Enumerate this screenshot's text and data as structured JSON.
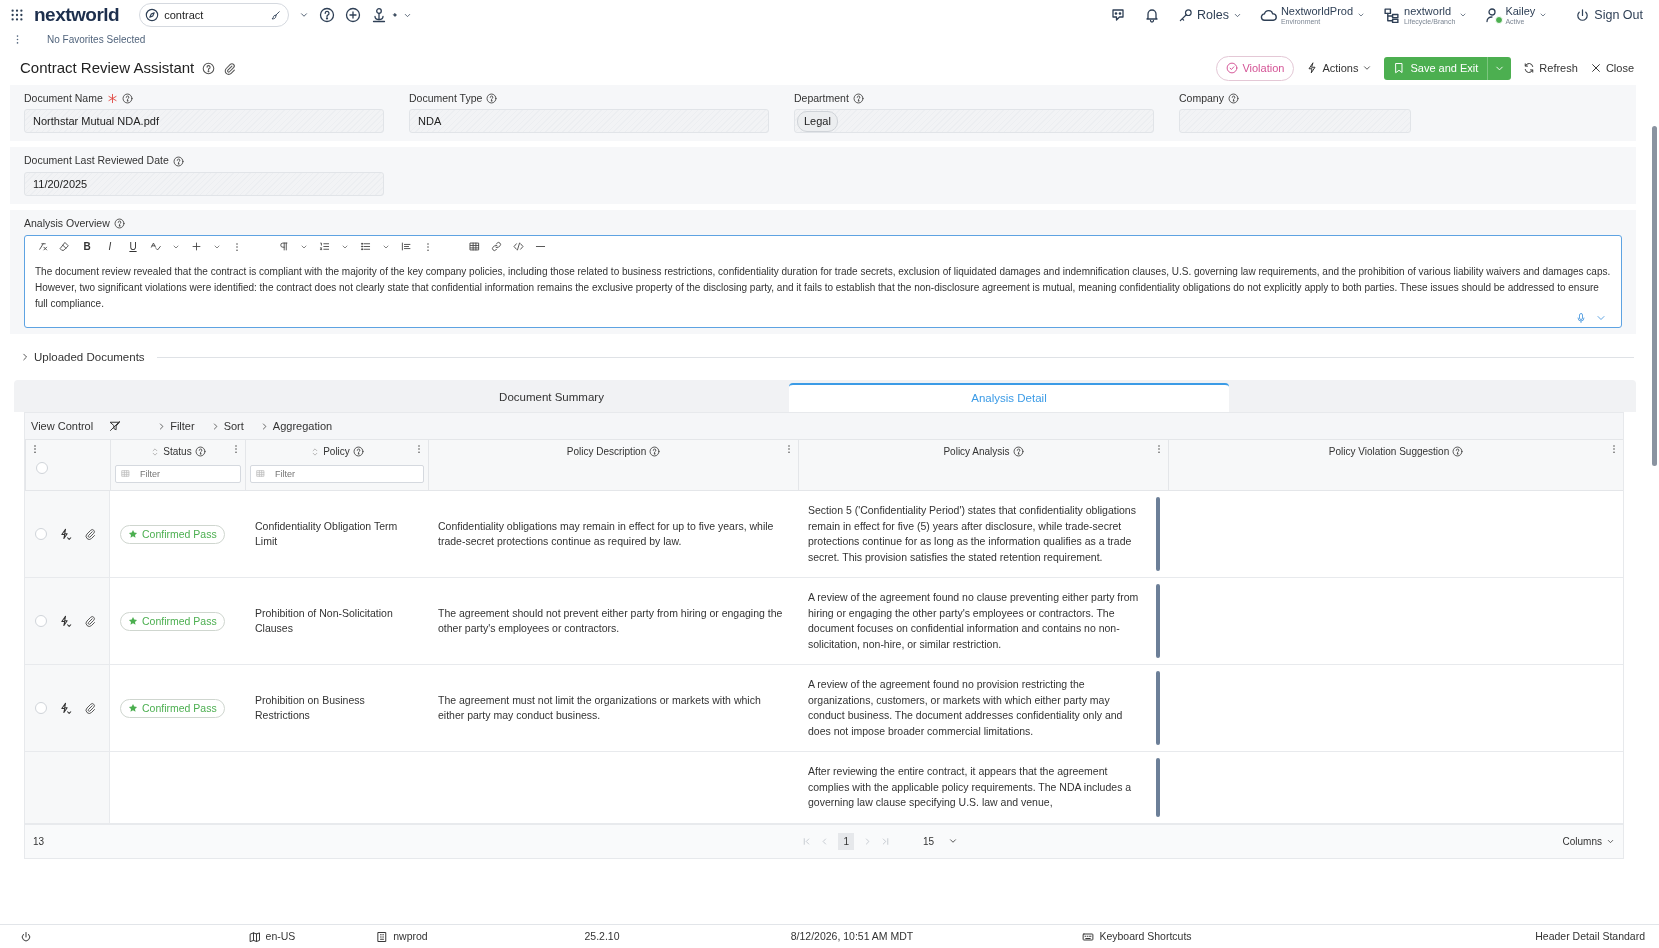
{
  "header": {
    "logo": "nextworld",
    "search": {
      "value": "contract"
    },
    "roles": "Roles",
    "environment": {
      "name": "NextworldProd",
      "caption": "Environment"
    },
    "branch": {
      "name": "nextworld",
      "caption": "Lifecycle/Branch"
    },
    "user": {
      "name": "Kailey",
      "caption": "Active",
      "online": true
    },
    "sign_out": "Sign Out"
  },
  "favorites": {
    "text": "No Favorites Selected"
  },
  "page": {
    "title": "Contract Review Assistant"
  },
  "actions": {
    "violation": "Violation",
    "actions": "Actions",
    "save": "Save and Exit",
    "refresh": "Refresh",
    "close": "Close"
  },
  "field_groups": [
    [
      {
        "label": "Document Name",
        "required": true,
        "kind": "text",
        "value": "Northstar Mutual NDA.pdf"
      },
      {
        "label": "Document Type",
        "required": false,
        "kind": "text",
        "value": "NDA"
      },
      {
        "label": "Department",
        "required": false,
        "kind": "tag",
        "value": "Legal"
      },
      {
        "label": "Company",
        "required": false,
        "kind": "text"
      }
    ],
    [
      {
        "label": "Document Last Reviewed Date",
        "required": false,
        "kind": "text",
        "value": "11/20/2025"
      }
    ]
  ],
  "analysis_overview": {
    "label": "Analysis Overview",
    "format_buttons": [
      "B",
      "I",
      "U"
    ],
    "text": "The document review revealed that the contract is compliant with the majority of the key company policies, including those related to business restrictions, confidentiality duration for trade secrets, exclusion of liquidated damages and indemnification clauses, U.S. governing law requirements, and the prohibition of various liability waivers and damages caps. However, two significant violations were identified: the contract does not clearly state that confidential information remains the exclusive property of the disclosing party, and it fails to establish that the non-disclosure agreement is mutual, meaning confidentiality obligations do not explicitly apply to both parties. These issues should be addressed to ensure full compliance."
  },
  "uploaded_documents": {
    "label": "Uploaded Documents",
    "expanded": false
  },
  "tabs": [
    {
      "label": "Document Summary",
      "selected": false
    },
    {
      "label": "Analysis Detail",
      "selected": true
    }
  ],
  "view_control": {
    "label": "View Control",
    "options": [
      "Filter",
      "Sort",
      "Aggregation"
    ]
  },
  "table": {
    "select_all": {
      "selected": false
    },
    "columns": [
      {
        "label": "Status",
        "sortable": true,
        "filter": {
          "placeholder": "Filter"
        }
      },
      {
        "label": "Policy",
        "sortable": true,
        "filter": {
          "placeholder": "Filter"
        }
      },
      {
        "label": "Policy Description",
        "sortable": false
      },
      {
        "label": "Policy Analysis",
        "sortable": false
      },
      {
        "label": "Policy Violation Suggestion",
        "sortable": false
      }
    ],
    "rows": [
      {
        "selected": false,
        "status": "Confirmed Pass",
        "policy": "Confidentiality Obligation Term Limit",
        "description": "Confidentiality obligations may remain in effect for up to five years, while trade-secret protections continue as required by law.",
        "analysis": "Section 5 ('Confidentiality Period') states that confidentiality obligations remain in effect for five (5) years after disclosure, while trade-secret protections continue for as long as the information qualifies as a trade secret. This provision satisfies the stated retention requirement."
      },
      {
        "selected": false,
        "status": "Confirmed Pass",
        "policy": "Prohibition of Non-Solicitation Clauses",
        "description": "The agreement should not prevent either party from hiring or engaging the other party's employees or contractors.",
        "analysis": "A review of the agreement found no clause preventing either party from hiring or engaging the other party's employees or contractors. The document focuses on confidential information and contains no non-solicitation, non-hire, or similar restriction."
      },
      {
        "selected": false,
        "status": "Confirmed Pass",
        "policy": "Prohibition on Business Restrictions",
        "description": "The agreement must not limit the organizations or markets with which either party may conduct business.",
        "analysis": "A review of the agreement found no provision restricting the organizations, customers, or markets with which either party may conduct business. The document addresses confidentiality only and does not impose broader commercial limitations."
      },
      {
        "analysis": "After reviewing the entire contract, it appears that the agreement complies with the applicable policy requirements. The NDA includes a governing law clause specifying U.S. law and venue,"
      }
    ]
  },
  "pagination": {
    "total": "13",
    "page": "1",
    "page_size": "15",
    "columns": "Columns"
  },
  "status_bar": {
    "locale": "en-US",
    "tenant": "nwprod",
    "version": "25.2.10",
    "datetime": "8/12/2026, 10:51 AM MDT",
    "shortcuts": "Keyboard Shortcuts",
    "layout": "Header Detail Standard"
  }
}
